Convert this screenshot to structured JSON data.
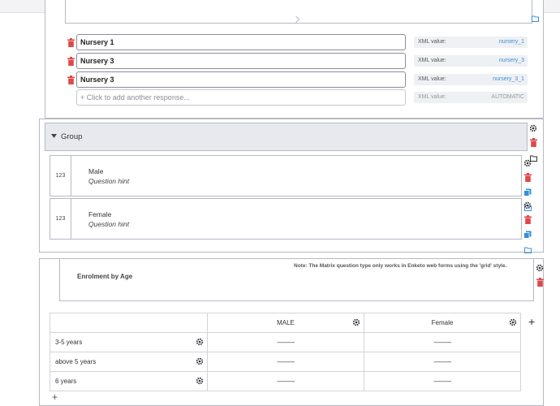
{
  "choices": {
    "responses": [
      {
        "label": "Nursery 1",
        "xml_label": "XML value:",
        "xml_value": "nursery_1"
      },
      {
        "label": "Nursery 3",
        "xml_label": "XML value:",
        "xml_value": "nursery_3"
      },
      {
        "label": "Nursery 3",
        "xml_label": "XML value:",
        "xml_value": "nursery_3_1"
      }
    ],
    "add_placeholder": "+ Click to add another response...",
    "add_xml_label": "XML value:",
    "add_xml_value": "AUTOMATIC"
  },
  "group": {
    "title": "Group",
    "questions": [
      {
        "type": "123",
        "label": "Male",
        "hint": "Question hint"
      },
      {
        "type": "123",
        "label": "Female",
        "hint": "Question hint"
      }
    ]
  },
  "matrix": {
    "note": "Note: The Matrix question type only works in Enketo web forms using the 'grid' style.",
    "title": "Enrolment by Age",
    "columns": [
      "MALE",
      "Female"
    ],
    "rows": [
      "3-5 years",
      "above 5 years",
      "6 years"
    ],
    "cell_placeholder": "----------",
    "add_column": "+",
    "add_row": "+"
  },
  "colors": {
    "accent": "#3b8fd8",
    "danger": "#e04848",
    "border": "#b7b9c4"
  },
  "icons": [
    "trash-icon",
    "gear-icon",
    "duplicate-icon",
    "folder-icon",
    "caret-down-icon",
    "plus-icon"
  ]
}
